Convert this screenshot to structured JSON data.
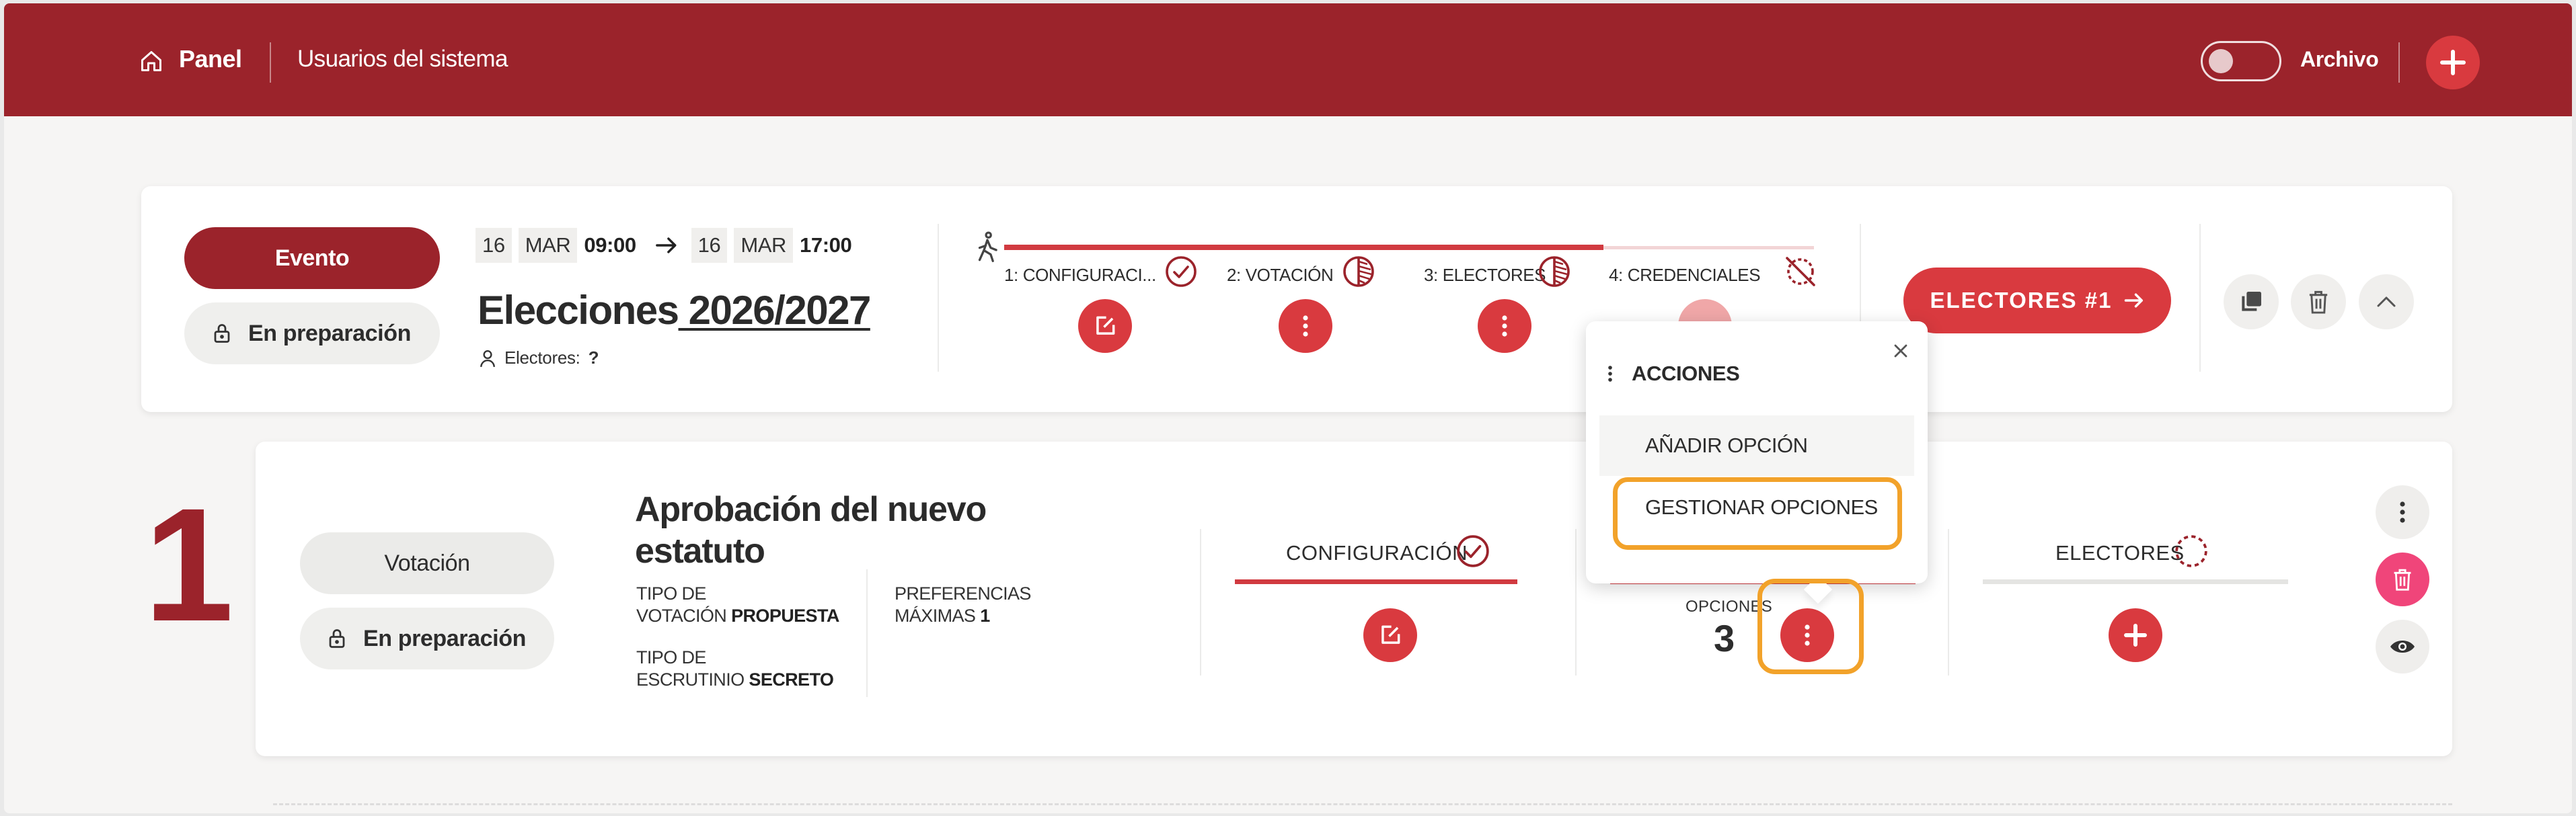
{
  "header": {
    "panel_label": "Panel",
    "users_label": "Usuarios del sistema",
    "archive_label": "Archivo",
    "archive_toggle_on": false,
    "add_button_icon": "plus-icon",
    "brand_color": "#9b232b",
    "accent_color": "#d93a3f"
  },
  "event": {
    "type_label": "Evento",
    "state_label": "En preparación",
    "start_day": "16",
    "start_month": "MAR",
    "start_time": "09:00",
    "end_day": "16",
    "end_month": "MAR",
    "end_time": "17:00",
    "title_prefix": "Elecciones",
    "title_year": " 2026/2027",
    "electores_label": "Electores:",
    "electores_value": "?",
    "steps": [
      {
        "label": "1: CONFIGURACI...",
        "status_icon": "check-circle-icon",
        "action_icon": "edit-icon"
      },
      {
        "label": "2: VOTACIÓN",
        "status_icon": "half-circle-icon",
        "action_icon": "more-vertical-icon"
      },
      {
        "label": "3: ELECTORES",
        "status_icon": "half-circle-icon",
        "action_icon": "more-vertical-icon"
      },
      {
        "label": "4: CREDENCIALES",
        "status_icon": "blocked-circle-icon",
        "action_icon": "more-vertical-icon"
      }
    ],
    "progress": 0.74,
    "electores_button": "ELECTORES #1"
  },
  "vote": {
    "number": "1",
    "type_label": "Votación",
    "state_label": "En preparación",
    "title": "Aprobación del nuevo estatuto",
    "tipo_votacion_label_1": "TIPO DE",
    "tipo_votacion_label_2": "VOTACIÓN",
    "tipo_votacion_value": "PROPUESTA",
    "preferencias_label_1": "PREFERENCIAS",
    "preferencias_label_2": "MÁXIMAS",
    "preferencias_value": "1",
    "tipo_escrutinio_label_1": "TIPO DE",
    "tipo_escrutinio_label_2": "ESCRUTINIO",
    "tipo_escrutinio_value": "SECRETO",
    "config_label": "CONFIGURACIÓN",
    "opciones_label": "OPCIONES",
    "opciones_count": "3",
    "electores_label": "ELECTORES"
  },
  "popover": {
    "title": "ACCIONES",
    "items": [
      "AÑADIR OPCIÓN",
      "GESTIONAR OPCIONES"
    ],
    "highlight_color": "#f2a22a"
  }
}
